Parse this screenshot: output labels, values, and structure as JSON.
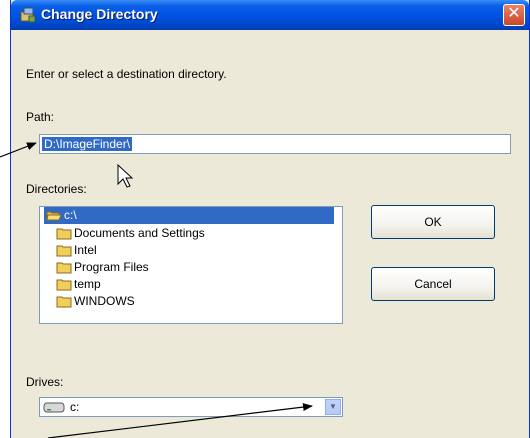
{
  "window": {
    "title": "Change Directory",
    "close_label": "✕"
  },
  "instruction": "Enter or select a destination directory.",
  "path": {
    "label": "Path:",
    "value": "D:\\ImageFinder\\"
  },
  "directories": {
    "label": "Directories:",
    "items": [
      {
        "name": "c:\\",
        "icon": "open-folder-icon",
        "selected": true
      },
      {
        "name": "Documents and Settings",
        "icon": "folder-icon",
        "selected": false
      },
      {
        "name": "Intel",
        "icon": "folder-icon",
        "selected": false
      },
      {
        "name": "Program Files",
        "icon": "folder-icon",
        "selected": false
      },
      {
        "name": "temp",
        "icon": "folder-icon",
        "selected": false
      },
      {
        "name": "WINDOWS",
        "icon": "folder-icon",
        "selected": false
      }
    ]
  },
  "buttons": {
    "ok": "OK",
    "cancel": "Cancel"
  },
  "drives": {
    "label": "Drives:",
    "value": "c:",
    "icon": "drive-icon"
  },
  "colors": {
    "title_bar": "#0054e3",
    "selection": "#316ac5",
    "dialog_bg": "#ece9d8"
  }
}
